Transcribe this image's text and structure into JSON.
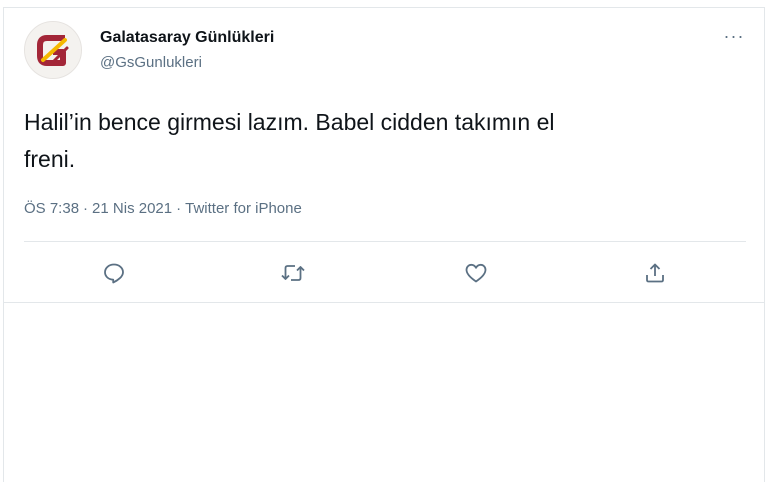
{
  "tweet": {
    "author": {
      "display_name": "Galatasaray Günlükleri",
      "handle": "@GsGunlukleri",
      "avatar_icon": "galatasaray-g-logo"
    },
    "more_label": "···",
    "text": "Halil’in bence girmesi lazım. Babel cidden takımın el\nfreni.",
    "time": "ÖS 7:38",
    "separator": "·",
    "date": "21 Nis 2021",
    "source": "Twitter for iPhone",
    "actions": [
      {
        "name": "reply",
        "icon": "reply-icon"
      },
      {
        "name": "retweet",
        "icon": "retweet-icon"
      },
      {
        "name": "like",
        "icon": "heart-icon"
      },
      {
        "name": "share",
        "icon": "share-icon"
      }
    ]
  },
  "colors": {
    "text_primary": "#0f1419",
    "text_secondary": "#5b7083",
    "border": "#e3e7ea",
    "brand_red": "#a32638",
    "brand_yellow": "#f5b800"
  }
}
